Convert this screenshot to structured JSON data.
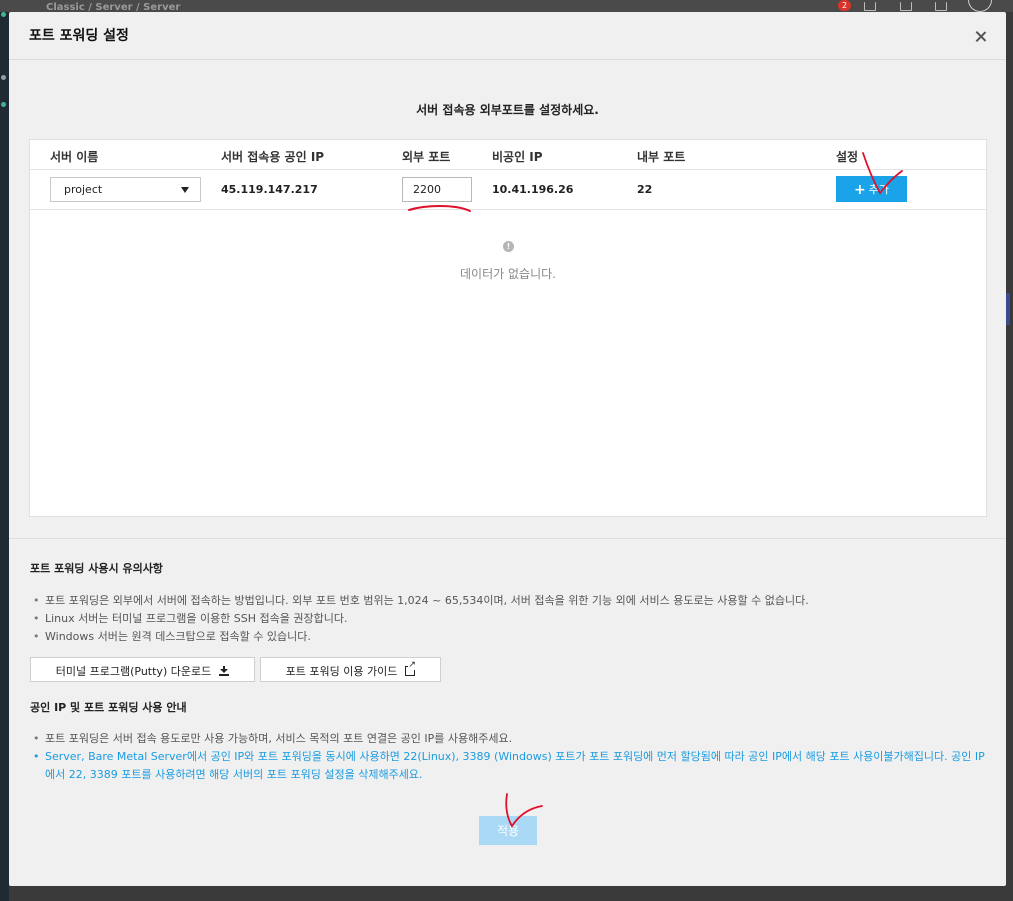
{
  "background": {
    "breadcrumb": "Classic / Server / Server",
    "notification_count": "2"
  },
  "modal": {
    "title": "포트 포워딩 설정",
    "instruction": "서버 접속용 외부포트를 설정하세요.",
    "table": {
      "headers": {
        "server_name": "서버 이름",
        "public_ip": "서버 접속용 공인 IP",
        "external_port": "외부 포트",
        "private_ip": "비공인 IP",
        "internal_port": "내부 포트",
        "settings": "설정"
      },
      "row": {
        "server_name": "project",
        "public_ip": "45.119.147.217",
        "external_port": "2200",
        "private_ip": "10.41.196.26",
        "internal_port": "22",
        "add_label": "추가"
      },
      "empty_icon": "!",
      "empty_text": "데이터가 없습니다."
    },
    "notes": {
      "title": "포트 포워딩 사용시 유의사항",
      "items": [
        "포트 포워딩은 외부에서 서버에 접속하는 방법입니다. 외부 포트 번호 범위는 1,024 ~ 65,534이며, 서버 접속을 위한 기능 외에 서비스 용도로는 사용할 수 없습니다.",
        "Linux 서버는 터미널 프로그램을 이용한 SSH 접속을 권장합니다.",
        "Windows 서버는 원격 데스크탑으로 접속할 수 있습니다."
      ],
      "putty_download": "터미널 프로그램(Putty) 다운로드",
      "guide": "포트 포워딩 이용 가이드"
    },
    "info": {
      "title": "공인 IP 및 포트 포워딩 사용 안내",
      "items": [
        "포트 포워딩은 서버 접속 용도로만 사용 가능하며, 서비스 목적의 포트 연결은 공인 IP를 사용해주세요.",
        "Server, Bare Metal Server에서 공인 IP와 포트 포워딩을 동시에 사용하면 22(Linux), 3389 (Windows) 포트가 포트 포워딩에 먼저 할당됨에 따라 공인 IP에서 해당 포트 사용이불가해집니다. 공인 IP에서 22, 3389 포트를 사용하려면 해당 서버의 포트 포워딩 설정을 삭제해주세요."
      ]
    },
    "apply_label": "적용"
  },
  "colors": {
    "primary_button": "#1aa3e8",
    "disabled_button": "#a9d9f4",
    "info_text": "#1a9be0",
    "annotation": "#e0102a"
  },
  "icons": {
    "close": "close-icon",
    "dropdown": "chevron-down-icon",
    "add": "plus-icon",
    "empty": "info-icon",
    "download": "download-icon",
    "external": "external-link-icon"
  }
}
